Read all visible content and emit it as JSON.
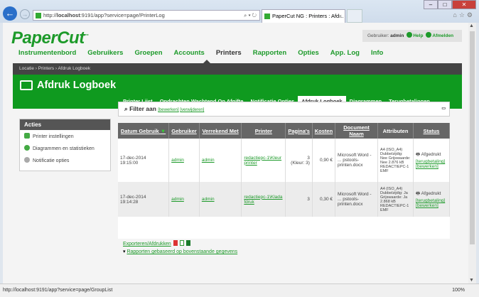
{
  "browser": {
    "url_prefix": "http://",
    "url_host": "localhost",
    "url_rest": ":9191/app?service=page/PrinterLog",
    "tab_title": "PaperCut NG : Printers : Afd...",
    "tab_close": "×",
    "status_url": "http://localhost:9191/app?service=page/GroupList",
    "zoom": "100%"
  },
  "header": {
    "logo": "PaperCut",
    "tm": "™",
    "user_label": "Gebruiker:",
    "user": "admin",
    "help": "Help",
    "logout": "Afmelden"
  },
  "nav": [
    "Instrumentenbord",
    "Gebruikers",
    "Groepen",
    "Accounts",
    "Printers",
    "Rapporten",
    "Opties",
    "App. Log",
    "Info"
  ],
  "breadcrumb": "Locatie  ›  Printers  ›  Afdruk Logboek",
  "page_title": "Afdruk Logboek",
  "subtabs": [
    "Printer Lijst",
    "Opdrachten Wachtend Op Afgifte",
    "Notificatie Opties",
    "Afdruk Logboek",
    "Diagrammen",
    "Terugbetalingen"
  ],
  "acties": {
    "title": "Acties",
    "items": [
      "Printer instellingen",
      "Diagrammen en statistieken",
      "Notificatie opties"
    ]
  },
  "filter": {
    "label": "Filter aan",
    "edit": "[bewerken]",
    "remove": "[verwijderen]"
  },
  "table": {
    "headers": [
      "Datum Gebruik",
      "Gebruiker",
      "Verrekend Met",
      "Printer",
      "Pagina's",
      "Kosten",
      "Document Naam",
      "Attributen",
      "Status"
    ],
    "rows": [
      {
        "date": "17-dec-2014",
        "time": "19:15:00",
        "user": "admin",
        "charged": "admin",
        "printer": "redactiepc-1\\Kleurprinter",
        "pages": "3",
        "pages_note": "(Kleur: 3)",
        "cost": "0,90 €",
        "doc": "Microsoft Word - ... pstools-printen.docx",
        "attrs": "A4 (ISO_A4) Dubbelzijdig: Nee Grijswaarde: Nee 2.876 kB REDACTIEPC-1 EMF",
        "status": "Afgedrukt",
        "refund": "[terugbetaling]",
        "edit": "[bewerken]"
      },
      {
        "date": "17-dec-2014",
        "time": "19:14:28",
        "user": "admin",
        "charged": "admin",
        "printer": "redactiepc-1\\Kladafdruk",
        "pages": "3",
        "pages_note": "",
        "cost": "0,30 €",
        "doc": "Microsoft Word - ... pstools-printen.docx",
        "attrs": "A4 (ISO_A4) Dubbelzijdig: Ja Grijswaarde: Ja 2.868 kB REDACTIEPC-1 EMF",
        "status": "Afgedrukt",
        "refund": "[terugbetaling]",
        "edit": "[bewerken]"
      }
    ]
  },
  "footer": {
    "export": "Exporteren/Afdrukken",
    "reports": "Rapporten gebaseerd op bovenstaande gegevens"
  }
}
